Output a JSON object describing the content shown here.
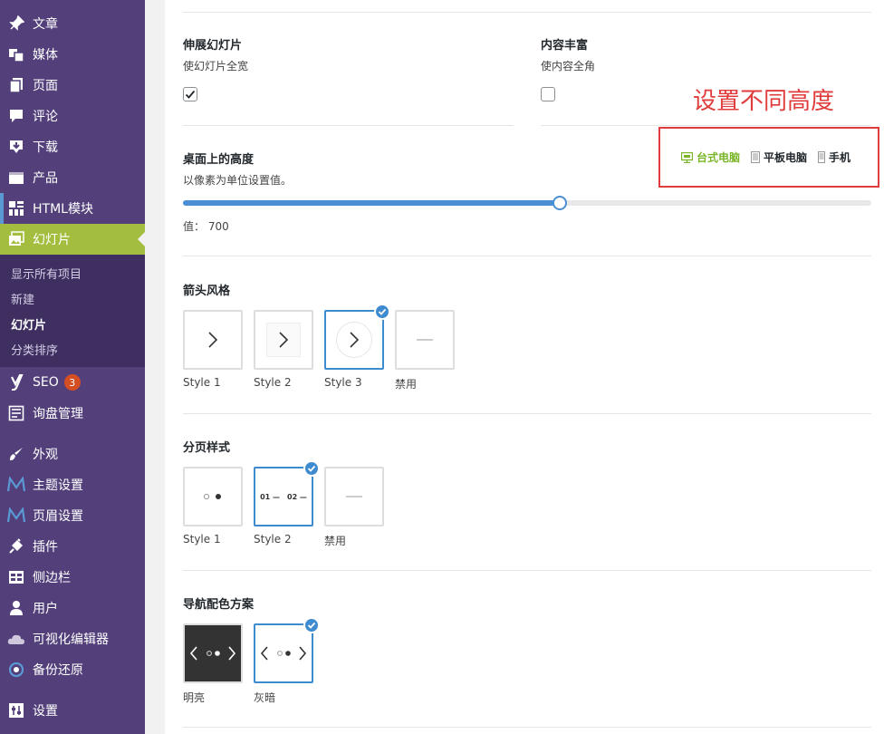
{
  "sidebar": {
    "items": [
      {
        "label": "文章",
        "icon": "pin-icon"
      },
      {
        "label": "媒体",
        "icon": "media-icon"
      },
      {
        "label": "页面",
        "icon": "page-icon"
      },
      {
        "label": "评论",
        "icon": "comment-icon"
      },
      {
        "label": "下载",
        "icon": "download-icon"
      },
      {
        "label": "产品",
        "icon": "product-icon"
      },
      {
        "label": "HTML模块",
        "icon": "grid-icon"
      },
      {
        "label": "幻灯片",
        "icon": "slides-icon"
      }
    ],
    "submenu": [
      "显示所有项目",
      "新建",
      "幻灯片",
      "分类排序"
    ],
    "lower_items": [
      {
        "label": "SEO",
        "icon": "yoast-icon",
        "badge": "3"
      },
      {
        "label": "询盘管理",
        "icon": "inquiry-icon"
      },
      {
        "label": "外观",
        "icon": "brush-icon"
      },
      {
        "label": "主题设置",
        "icon": "m-logo-icon"
      },
      {
        "label": "页眉设置",
        "icon": "m-logo-icon"
      },
      {
        "label": "插件",
        "icon": "plugin-icon"
      },
      {
        "label": "侧边栏",
        "icon": "sidebar-icon"
      },
      {
        "label": "用户",
        "icon": "user-icon"
      },
      {
        "label": "可视化编辑器",
        "icon": "cloud-icon"
      },
      {
        "label": "备份还原",
        "icon": "backup-icon"
      },
      {
        "label": "设置",
        "icon": "settings-icon"
      }
    ]
  },
  "settings": {
    "stretch": {
      "title": "伸展幻灯片",
      "desc": "使幻灯片全宽",
      "checked": true
    },
    "full_content": {
      "title": "内容丰富",
      "desc": "使内容全角",
      "checked": false
    },
    "annotation": "设置不同高度",
    "height": {
      "title": "桌面上的高度",
      "desc": "以像素为单位设置值。",
      "value_label": "值： 700",
      "fraction": 0.548
    },
    "devices": [
      "台式电脑",
      "平板电脑",
      "手机"
    ],
    "arrow_style": {
      "title": "箭头风格",
      "options": [
        "Style 1",
        "Style 2",
        "Style 3",
        "禁用"
      ],
      "selected": "Style 3"
    },
    "pagination": {
      "title": "分页样式",
      "options": [
        "Style 1",
        "Style 2",
        "禁用"
      ],
      "selected": "Style 2",
      "style2_text_a": "01 —",
      "style2_text_b": "02 —"
    },
    "nav_scheme": {
      "title": "导航配色方案",
      "options": [
        "明亮",
        "灰暗"
      ],
      "selected": "灰暗"
    }
  },
  "colors": {
    "sidebar_bg": "#53407b",
    "active_bg": "#a3be3f",
    "accent_blue": "#4a8fd3",
    "device_active": "#7ab528",
    "annotation_red": "#e03c3c"
  }
}
